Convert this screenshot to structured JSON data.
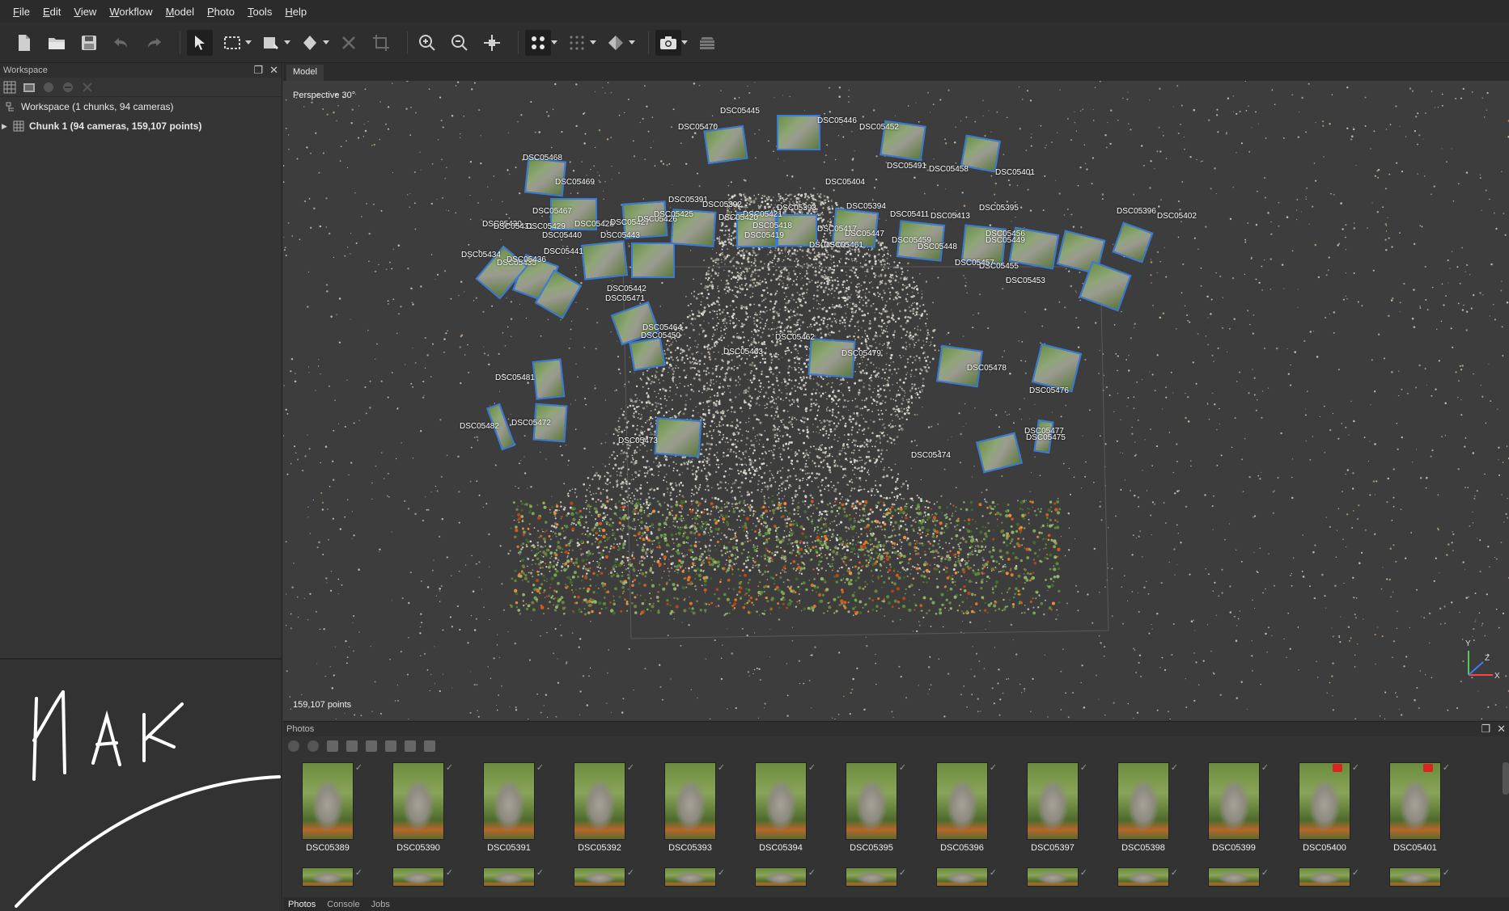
{
  "menu": [
    "File",
    "Edit",
    "View",
    "Workflow",
    "Model",
    "Photo",
    "Tools",
    "Help"
  ],
  "toolbar": {
    "icons": [
      "new-file-icon",
      "open-folder-icon",
      "save-icon",
      "undo-icon",
      "redo-icon",
      "select-arrow-icon",
      "rect-select-icon",
      "move-region-icon",
      "rotate-object-icon",
      "delete-icon",
      "crop-icon",
      "zoom-in-icon",
      "zoom-out-icon",
      "reset-view-icon",
      "point-cloud-icon",
      "dense-cloud-icon",
      "model-shaded-icon",
      "camera-icon",
      "tiled-model-icon"
    ]
  },
  "workspace": {
    "title": "Workspace",
    "root_label": "Workspace (1 chunks, 94 cameras)",
    "chunk_label": "Chunk 1 (94 cameras, 159,107 points)"
  },
  "model": {
    "tab": "Model",
    "projection": "Perspective 30°",
    "points_count": "159,107 points",
    "axis": {
      "x": "X",
      "y": "Y",
      "z": "Z"
    },
    "camera_labels": [
      "DSC05445",
      "DSC05446",
      "DSC05452",
      "DSC05470",
      "DSC05468",
      "DSC05469",
      "DSC05467",
      "DSC05428",
      "DSC05427",
      "DSC05426",
      "DSC05425",
      "DSC05391",
      "DSC05392",
      "DSC05393",
      "DSC05394",
      "DSC05395",
      "DSC05396",
      "DSC05402",
      "DSC05401",
      "DSC05404",
      "DSC05460",
      "DSC05430",
      "DSC05431",
      "DSC05429",
      "DSC05440",
      "DSC05443",
      "DSC05441",
      "DSC05434",
      "DSC05435",
      "DSC05436",
      "DSC05442",
      "DSC05471",
      "DSC05464",
      "DSC05450",
      "DSC05462",
      "DSC05463",
      "DSC05479",
      "DSC05478",
      "DSC05476",
      "DSC05477",
      "DSC05475",
      "DSC05474",
      "DSC05473",
      "DSC05472",
      "DSC05481",
      "DSC05482",
      "DSC05453",
      "DSC05455",
      "DSC05457",
      "DSC05459",
      "DSC05461",
      "DSC05447",
      "DSC05448",
      "DSC05449",
      "DSC05456",
      "DSC05411",
      "DSC05413",
      "DSC05417",
      "DSC05419",
      "DSC05418",
      "DSC05421",
      "DSC05420",
      "DSC05491",
      "DSC05458"
    ]
  },
  "photos": {
    "title": "Photos",
    "items": [
      "DSC05389",
      "DSC05390",
      "DSC05391",
      "DSC05392",
      "DSC05393",
      "DSC05394",
      "DSC05395",
      "DSC05396",
      "DSC05397",
      "DSC05398",
      "DSC05399",
      "DSC05400",
      "DSC05401"
    ],
    "flagged": [
      "DSC05400",
      "DSC05401"
    ],
    "check": "✓"
  },
  "bottom_tabs": [
    "Photos",
    "Console",
    "Jobs"
  ],
  "watermark": "HAK",
  "colors": {
    "camera_frame": "#3a7bd5",
    "bg": "#3d3d3d",
    "flag": "#dd2222"
  }
}
